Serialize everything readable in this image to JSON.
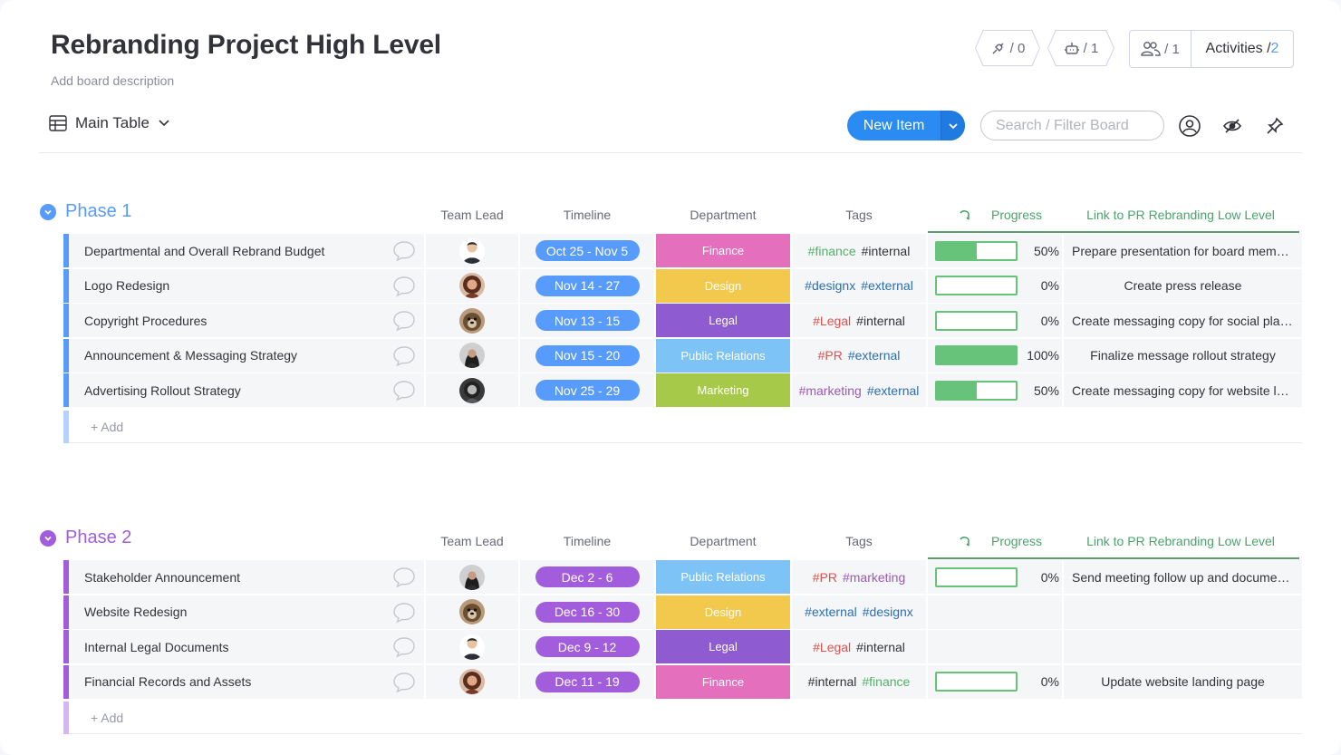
{
  "board": {
    "title": "Rebranding Project High Level",
    "description": "Add board description"
  },
  "header": {
    "integrations_count": "/ 0",
    "automations_count": "/ 1",
    "members_count": "/ 1",
    "activities_label": "Activities /",
    "activities_count": "2"
  },
  "toolbar": {
    "view_label": "Main Table",
    "new_item_label": "New Item",
    "search_placeholder": "Search / Filter Board"
  },
  "columns": {
    "team_lead": "Team Lead",
    "timeline": "Timeline",
    "department": "Department",
    "tags": "Tags",
    "progress": "Progress",
    "link": "Link to PR Rebranding Low Level"
  },
  "add_label": "+ Add",
  "colors": {
    "phase1": "#579bfc",
    "phase2": "#a25ddc",
    "timeline_blue": "#579bfc",
    "timeline_purple": "#a25ddc",
    "finance": "#e46fbd",
    "design": "#f2c94c",
    "legal": "#8e5bd0",
    "public_relations": "#7ec3f5",
    "marketing": "#a6c94a",
    "progress_green": "#67c27a"
  },
  "groups": [
    {
      "name": "Phase 1",
      "color": "#579bfc",
      "items": [
        {
          "name": "Departmental and Overall Rebrand Budget",
          "avatar": "avatar-man-suit",
          "timeline": "Oct 25 - Nov 5",
          "department": "Finance",
          "dept_color": "#e46fbd",
          "tags": [
            {
              "t": "#finance",
              "c": "#54b06a"
            },
            {
              "t": "#internal",
              "c": "#323338"
            }
          ],
          "progress": 50,
          "progress_label": "50%",
          "link": "Prepare presentation for board members"
        },
        {
          "name": "Logo Redesign",
          "avatar": "avatar-woman-curly",
          "timeline": "Nov 14 - 27",
          "department": "Design",
          "dept_color": "#f2c94c",
          "tags": [
            {
              "t": "#designx",
              "c": "#2b6fb3"
            },
            {
              "t": "#external",
              "c": "#2b6fb3"
            }
          ],
          "progress": 0,
          "progress_label": "0%",
          "link": "Create press release"
        },
        {
          "name": "Copyright Procedures",
          "avatar": "avatar-dog",
          "timeline": "Nov 13 - 15",
          "department": "Legal",
          "dept_color": "#8e5bd0",
          "tags": [
            {
              "t": "#Legal",
              "c": "#d9534f"
            },
            {
              "t": "#internal",
              "c": "#323338"
            }
          ],
          "progress": 0,
          "progress_label": "0%",
          "link": "Create messaging copy for social platforms"
        },
        {
          "name": "Announcement & Messaging Strategy",
          "avatar": "avatar-woman-dark",
          "timeline": "Nov 15 - 20",
          "department": "Public Relations",
          "dept_color": "#7ec3f5",
          "tags": [
            {
              "t": "#PR",
              "c": "#d9534f"
            },
            {
              "t": "#external",
              "c": "#2b6fb3"
            }
          ],
          "progress": 100,
          "progress_label": "100%",
          "link": "Finalize message rollout strategy"
        },
        {
          "name": "Advertising Rollout Strategy",
          "avatar": "avatar-woman-gray",
          "timeline": "Nov 25 - 29",
          "department": "Marketing",
          "dept_color": "#a6c94a",
          "tags": [
            {
              "t": "#marketing",
              "c": "#9b59b6"
            },
            {
              "t": "#external",
              "c": "#2b6fb3"
            }
          ],
          "progress": 50,
          "progress_label": "50%",
          "link": "Create messaging copy for website landing page"
        }
      ]
    },
    {
      "name": "Phase 2",
      "color": "#a25ddc",
      "items": [
        {
          "name": "Stakeholder Announcement",
          "avatar": "avatar-woman-dark",
          "timeline": "Dec 2 - 6",
          "department": "Public Relations",
          "dept_color": "#7ec3f5",
          "tags": [
            {
              "t": "#PR",
              "c": "#d9534f"
            },
            {
              "t": "#marketing",
              "c": "#9b59b6"
            }
          ],
          "progress": 0,
          "progress_label": "0%",
          "link": "Send meeting follow up and documents"
        },
        {
          "name": "Website Redesign",
          "avatar": "avatar-dog",
          "timeline": "Dec 16 - 30",
          "department": "Design",
          "dept_color": "#f2c94c",
          "tags": [
            {
              "t": "#external",
              "c": "#2b6fb3"
            },
            {
              "t": "#designx",
              "c": "#2b6fb3"
            }
          ],
          "progress": null,
          "progress_label": "",
          "link": ""
        },
        {
          "name": "Internal Legal Documents",
          "avatar": "avatar-man-suit",
          "timeline": "Dec 9 - 12",
          "department": "Legal",
          "dept_color": "#8e5bd0",
          "tags": [
            {
              "t": "#Legal",
              "c": "#d9534f"
            },
            {
              "t": "#internal",
              "c": "#323338"
            }
          ],
          "progress": null,
          "progress_label": "",
          "link": ""
        },
        {
          "name": "Financial Records and Assets",
          "avatar": "avatar-woman-curly",
          "timeline": "Dec 11 - 19",
          "department": "Finance",
          "dept_color": "#e46fbd",
          "tags": [
            {
              "t": "#internal",
              "c": "#323338"
            },
            {
              "t": "#finance",
              "c": "#54b06a"
            }
          ],
          "progress": 0,
          "progress_label": "0%",
          "link": "Update website landing page"
        }
      ]
    }
  ]
}
